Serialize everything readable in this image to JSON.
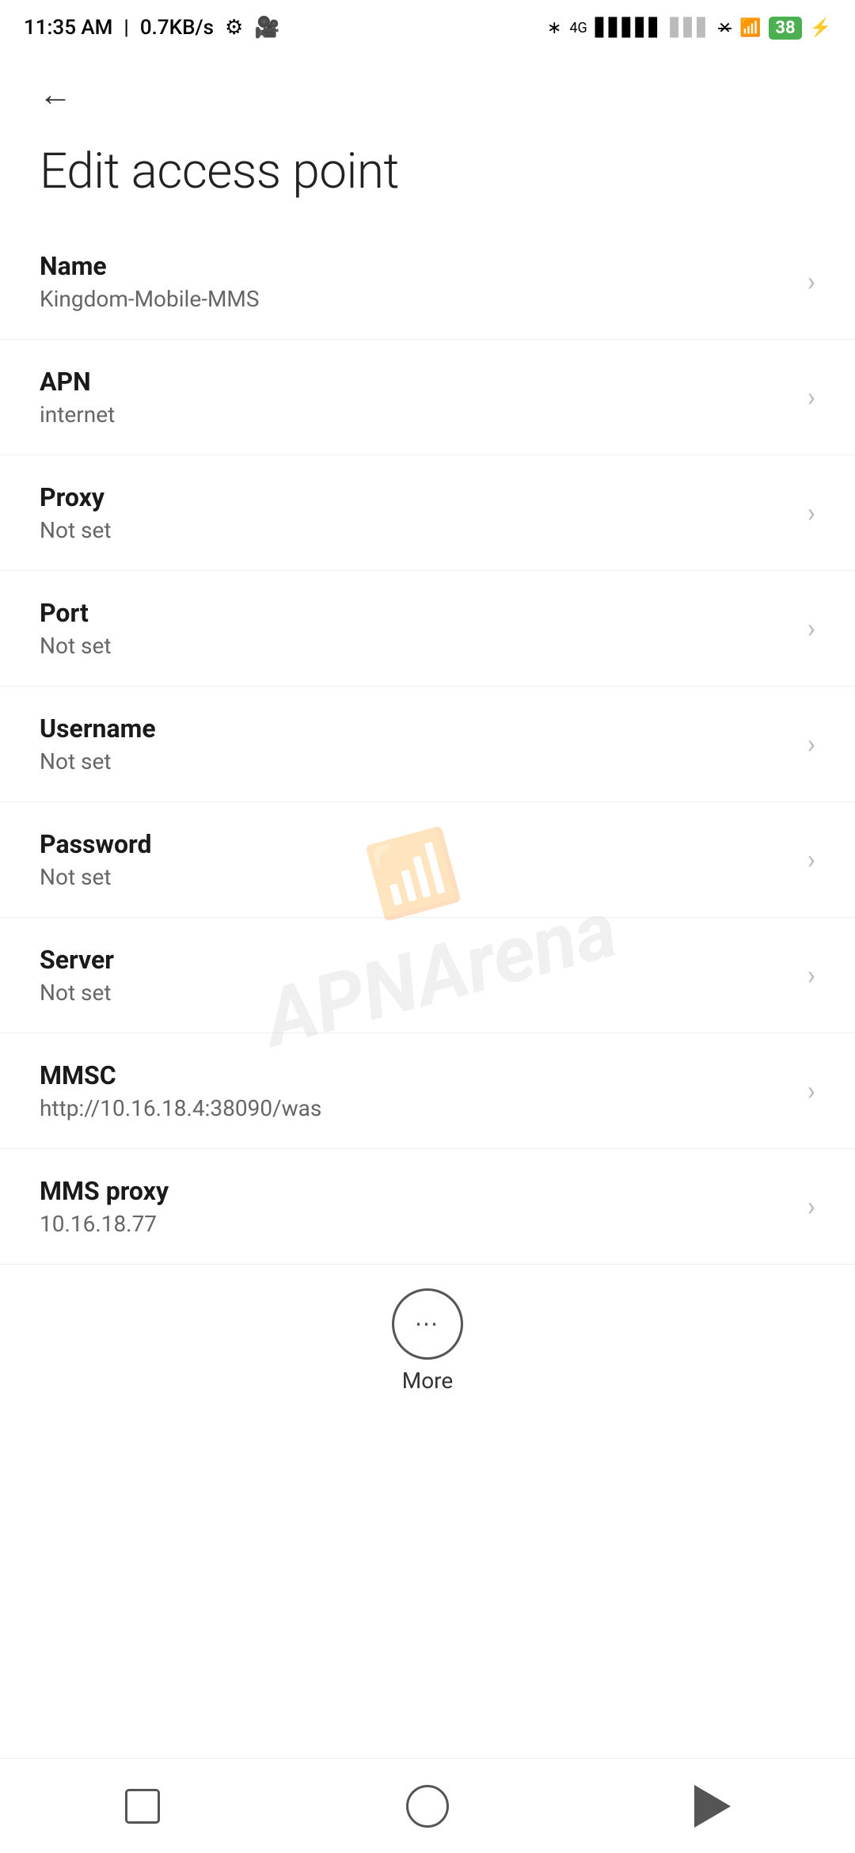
{
  "status_bar": {
    "time": "11:35 AM",
    "speed": "0.7KB/s"
  },
  "page": {
    "title": "Edit access point"
  },
  "settings_items": [
    {
      "label": "Name",
      "value": "Kingdom-Mobile-MMS",
      "id": "name"
    },
    {
      "label": "APN",
      "value": "internet",
      "id": "apn"
    },
    {
      "label": "Proxy",
      "value": "Not set",
      "id": "proxy"
    },
    {
      "label": "Port",
      "value": "Not set",
      "id": "port"
    },
    {
      "label": "Username",
      "value": "Not set",
      "id": "username"
    },
    {
      "label": "Password",
      "value": "Not set",
      "id": "password"
    },
    {
      "label": "Server",
      "value": "Not set",
      "id": "server"
    },
    {
      "label": "MMSC",
      "value": "http://10.16.18.4:38090/was",
      "id": "mmsc"
    },
    {
      "label": "MMS proxy",
      "value": "10.16.18.77",
      "id": "mms-proxy"
    }
  ],
  "more_button": {
    "label": "More"
  },
  "watermark": {
    "text": "APNArena"
  }
}
